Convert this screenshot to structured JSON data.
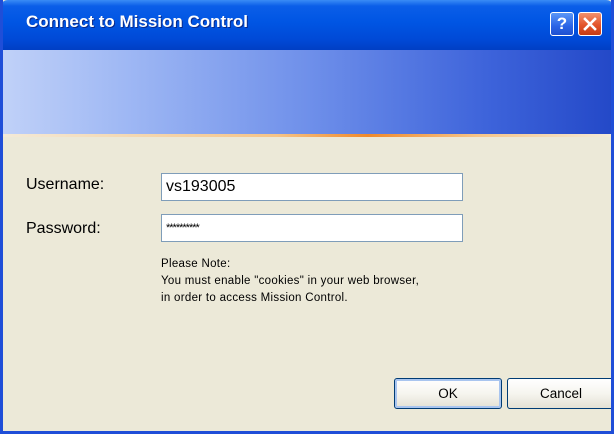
{
  "window": {
    "title": "Connect to Mission Control",
    "help_label": "?",
    "close_label": "✕"
  },
  "form": {
    "username_label": "Username:",
    "username_value": "vs193005",
    "password_label": "Password:",
    "password_value": "**********"
  },
  "note": {
    "line1": "Please Note:",
    "line2": "You must enable \"cookies\" in your web browser,",
    "line3": "in order to access Mission Control."
  },
  "buttons": {
    "ok_label": "OK",
    "cancel_label": "Cancel"
  }
}
